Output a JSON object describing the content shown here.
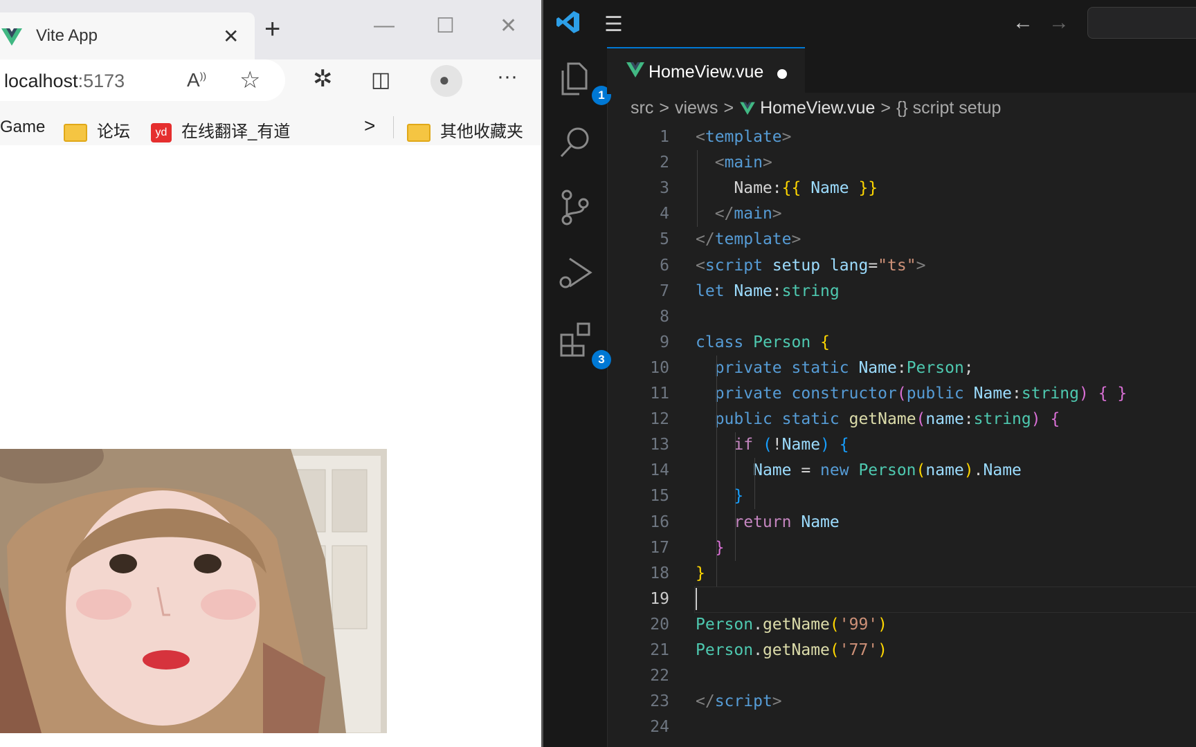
{
  "browser": {
    "tab_title": "Vite App",
    "tab_close": "✕",
    "new_tab": "+",
    "window_buttons": {
      "minimize": "—",
      "maximize": "☐",
      "close": "✕"
    },
    "address": {
      "host": "localhost",
      "port": ":5173"
    },
    "toolbar_icons": {
      "read_aloud": "A",
      "favorite": "☆",
      "extensions": "✲",
      "split": "◫",
      "profile": "●",
      "more": "···"
    },
    "bookmarks": [
      {
        "label": "Game"
      },
      {
        "label": "论坛",
        "icon": "folder-icon"
      },
      {
        "label": "在线翻译_有道",
        "icon": "yd-icon"
      },
      {
        "label": ">",
        "icon": "chevron-right-icon"
      },
      {
        "label": "其他收藏夹",
        "icon": "folder-icon"
      }
    ],
    "yd_badge": "yd"
  },
  "vscode": {
    "menu_icon": "☰",
    "nav_back": "←",
    "nav_forward": "→",
    "activity_badges": {
      "explorer": "1",
      "extensions": "3"
    },
    "file_tab": "HomeView.vue",
    "breadcrumbs": [
      "src",
      "views",
      "HomeView.vue",
      "{} script setup"
    ],
    "breadcrumb_sep": ">",
    "lines": [
      {
        "n": "1",
        "tokens": [
          [
            "t-br",
            "<"
          ],
          [
            "t-tag",
            "template"
          ],
          [
            "t-br",
            ">"
          ]
        ]
      },
      {
        "n": "2",
        "tokens": [
          [
            "t-plain",
            "  "
          ],
          [
            "t-br",
            "<"
          ],
          [
            "t-tag",
            "main"
          ],
          [
            "t-br",
            ">"
          ]
        ]
      },
      {
        "n": "3",
        "tokens": [
          [
            "t-plain",
            "    Name:"
          ],
          [
            "t-p1",
            "{{"
          ],
          [
            "t-plain",
            " "
          ],
          [
            "t-var",
            "Name"
          ],
          [
            "t-plain",
            " "
          ],
          [
            "t-p1",
            "}}"
          ]
        ]
      },
      {
        "n": "4",
        "tokens": [
          [
            "t-plain",
            "  "
          ],
          [
            "t-br",
            "</"
          ],
          [
            "t-tag",
            "main"
          ],
          [
            "t-br",
            ">"
          ]
        ]
      },
      {
        "n": "5",
        "tokens": [
          [
            "t-br",
            "</"
          ],
          [
            "t-tag",
            "template"
          ],
          [
            "t-br",
            ">"
          ]
        ]
      },
      {
        "n": "6",
        "tokens": [
          [
            "t-br",
            "<"
          ],
          [
            "t-tag",
            "script"
          ],
          [
            "t-plain",
            " "
          ],
          [
            "t-var",
            "setup"
          ],
          [
            "t-plain",
            " "
          ],
          [
            "t-var",
            "lang"
          ],
          [
            "t-plain",
            "="
          ],
          [
            "t-str",
            "\"ts\""
          ],
          [
            "t-br",
            ">"
          ]
        ]
      },
      {
        "n": "7",
        "tokens": [
          [
            "t-kw",
            "let"
          ],
          [
            "t-plain",
            " "
          ],
          [
            "t-var",
            "Name"
          ],
          [
            "t-plain",
            ":"
          ],
          [
            "t-type",
            "string"
          ]
        ]
      },
      {
        "n": "8",
        "tokens": []
      },
      {
        "n": "9",
        "tokens": [
          [
            "t-kw",
            "class"
          ],
          [
            "t-plain",
            " "
          ],
          [
            "t-type",
            "Person"
          ],
          [
            "t-plain",
            " "
          ],
          [
            "t-p1",
            "{"
          ]
        ]
      },
      {
        "n": "10",
        "tokens": [
          [
            "t-plain",
            "  "
          ],
          [
            "t-kw",
            "private"
          ],
          [
            "t-plain",
            " "
          ],
          [
            "t-kw",
            "static"
          ],
          [
            "t-plain",
            " "
          ],
          [
            "t-var",
            "Name"
          ],
          [
            "t-plain",
            ":"
          ],
          [
            "t-type",
            "Person"
          ],
          [
            "t-plain",
            ";"
          ]
        ]
      },
      {
        "n": "11",
        "tokens": [
          [
            "t-plain",
            "  "
          ],
          [
            "t-kw",
            "private"
          ],
          [
            "t-plain",
            " "
          ],
          [
            "t-kw",
            "constructor"
          ],
          [
            "t-p2",
            "("
          ],
          [
            "t-kw",
            "public"
          ],
          [
            "t-plain",
            " "
          ],
          [
            "t-var",
            "Name"
          ],
          [
            "t-plain",
            ":"
          ],
          [
            "t-type",
            "string"
          ],
          [
            "t-p2",
            ")"
          ],
          [
            "t-plain",
            " "
          ],
          [
            "t-p2",
            "{"
          ],
          [
            "t-plain",
            " "
          ],
          [
            "t-p2",
            "}"
          ]
        ]
      },
      {
        "n": "12",
        "tokens": [
          [
            "t-plain",
            "  "
          ],
          [
            "t-kw",
            "public"
          ],
          [
            "t-plain",
            " "
          ],
          [
            "t-kw",
            "static"
          ],
          [
            "t-plain",
            " "
          ],
          [
            "t-fn",
            "getName"
          ],
          [
            "t-p2",
            "("
          ],
          [
            "t-var",
            "name"
          ],
          [
            "t-plain",
            ":"
          ],
          [
            "t-type",
            "string"
          ],
          [
            "t-p2",
            ")"
          ],
          [
            "t-plain",
            " "
          ],
          [
            "t-p2",
            "{"
          ]
        ]
      },
      {
        "n": "13",
        "tokens": [
          [
            "t-plain",
            "    "
          ],
          [
            "t-ctl",
            "if"
          ],
          [
            "t-plain",
            " "
          ],
          [
            "t-p3",
            "("
          ],
          [
            "t-plain",
            "!"
          ],
          [
            "t-var",
            "Name"
          ],
          [
            "t-p3",
            ")"
          ],
          [
            "t-plain",
            " "
          ],
          [
            "t-p3",
            "{"
          ]
        ]
      },
      {
        "n": "14",
        "tokens": [
          [
            "t-plain",
            "      "
          ],
          [
            "t-var",
            "Name"
          ],
          [
            "t-plain",
            " = "
          ],
          [
            "t-kw",
            "new"
          ],
          [
            "t-plain",
            " "
          ],
          [
            "t-type",
            "Person"
          ],
          [
            "t-p1",
            "("
          ],
          [
            "t-var",
            "name"
          ],
          [
            "t-p1",
            ")"
          ],
          [
            "t-plain",
            "."
          ],
          [
            "t-var",
            "Name"
          ]
        ]
      },
      {
        "n": "15",
        "tokens": [
          [
            "t-plain",
            "    "
          ],
          [
            "t-p3",
            "}"
          ]
        ]
      },
      {
        "n": "16",
        "tokens": [
          [
            "t-plain",
            "    "
          ],
          [
            "t-ctl",
            "return"
          ],
          [
            "t-plain",
            " "
          ],
          [
            "t-var",
            "Name"
          ]
        ]
      },
      {
        "n": "17",
        "tokens": [
          [
            "t-plain",
            "  "
          ],
          [
            "t-p2",
            "}"
          ]
        ]
      },
      {
        "n": "18",
        "tokens": [
          [
            "t-p1",
            "}"
          ]
        ]
      },
      {
        "n": "19",
        "tokens": [],
        "active": true
      },
      {
        "n": "20",
        "tokens": [
          [
            "t-type",
            "Person"
          ],
          [
            "t-plain",
            "."
          ],
          [
            "t-fn",
            "getName"
          ],
          [
            "t-p1",
            "("
          ],
          [
            "t-str",
            "'99'"
          ],
          [
            "t-p1",
            ")"
          ]
        ]
      },
      {
        "n": "21",
        "tokens": [
          [
            "t-type",
            "Person"
          ],
          [
            "t-plain",
            "."
          ],
          [
            "t-fn",
            "getName"
          ],
          [
            "t-p1",
            "("
          ],
          [
            "t-str",
            "'77'"
          ],
          [
            "t-p1",
            ")"
          ]
        ]
      },
      {
        "n": "22",
        "tokens": []
      },
      {
        "n": "23",
        "tokens": [
          [
            "t-br",
            "</"
          ],
          [
            "t-tag",
            "script"
          ],
          [
            "t-br",
            ">"
          ]
        ]
      },
      {
        "n": "24",
        "tokens": []
      }
    ]
  }
}
